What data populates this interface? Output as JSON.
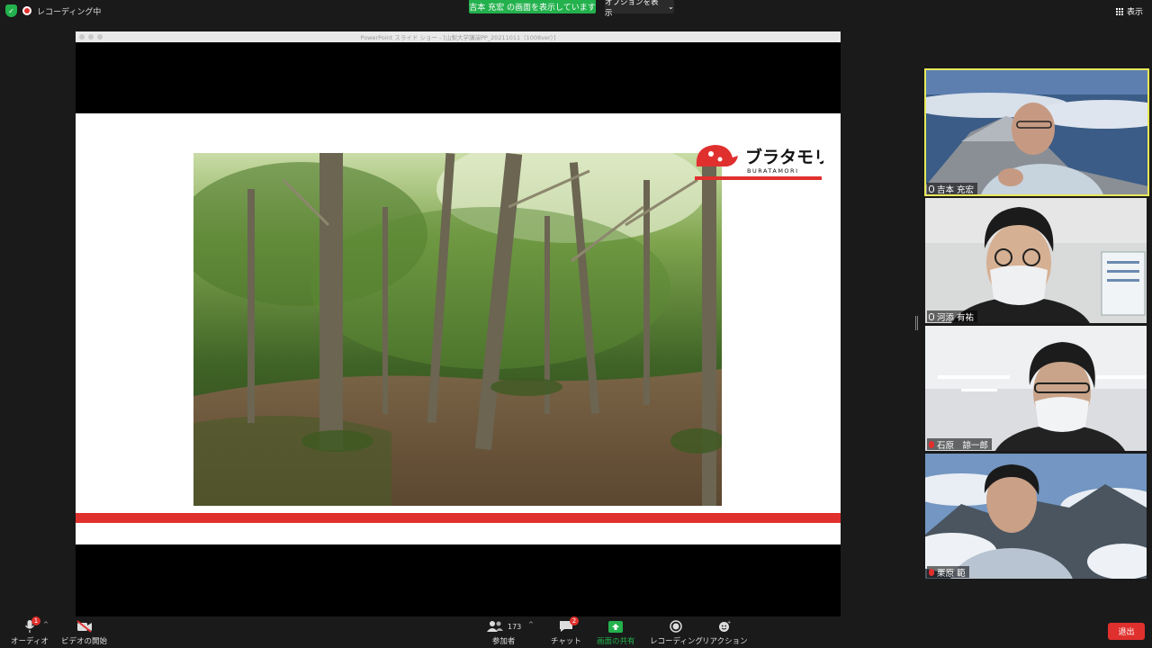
{
  "topbar": {
    "recording_label": "レコーディング中",
    "share_banner": "吉本 充宏 の画面を表示しています",
    "options_label": "オプションを表示",
    "view_label": "表示"
  },
  "shared_window": {
    "title": "PowerPoint スライド ショー - [山梨大学講演PP_20211011（1008ver）]",
    "logo_text": "ブラタモリ",
    "logo_subtext": "BURATAMORI",
    "accent_color": "#e0302e"
  },
  "participants": [
    {
      "name": "吉本 充宏",
      "muted": false,
      "active_speaker": true
    },
    {
      "name": "河添 有祐",
      "muted": false,
      "active_speaker": false
    },
    {
      "name": "石原　諒一郎",
      "muted": true,
      "active_speaker": false
    },
    {
      "name": "栗原 範",
      "muted": true,
      "active_speaker": false
    }
  ],
  "toolbar": {
    "audio_label": "オーディオ",
    "audio_badge": "1",
    "video_label": "ビデオの開始",
    "participants_label": "参加者",
    "participants_count": "173",
    "chat_label": "チャット",
    "chat_badge": "2",
    "share_label": "画面の共有",
    "record_label": "レコーディング",
    "reaction_label": "リアクション",
    "leave_label": "退出"
  },
  "colors": {
    "zoom_green": "#23b14d",
    "leave_red": "#e0302e",
    "active_outline": "#e8e85a"
  }
}
